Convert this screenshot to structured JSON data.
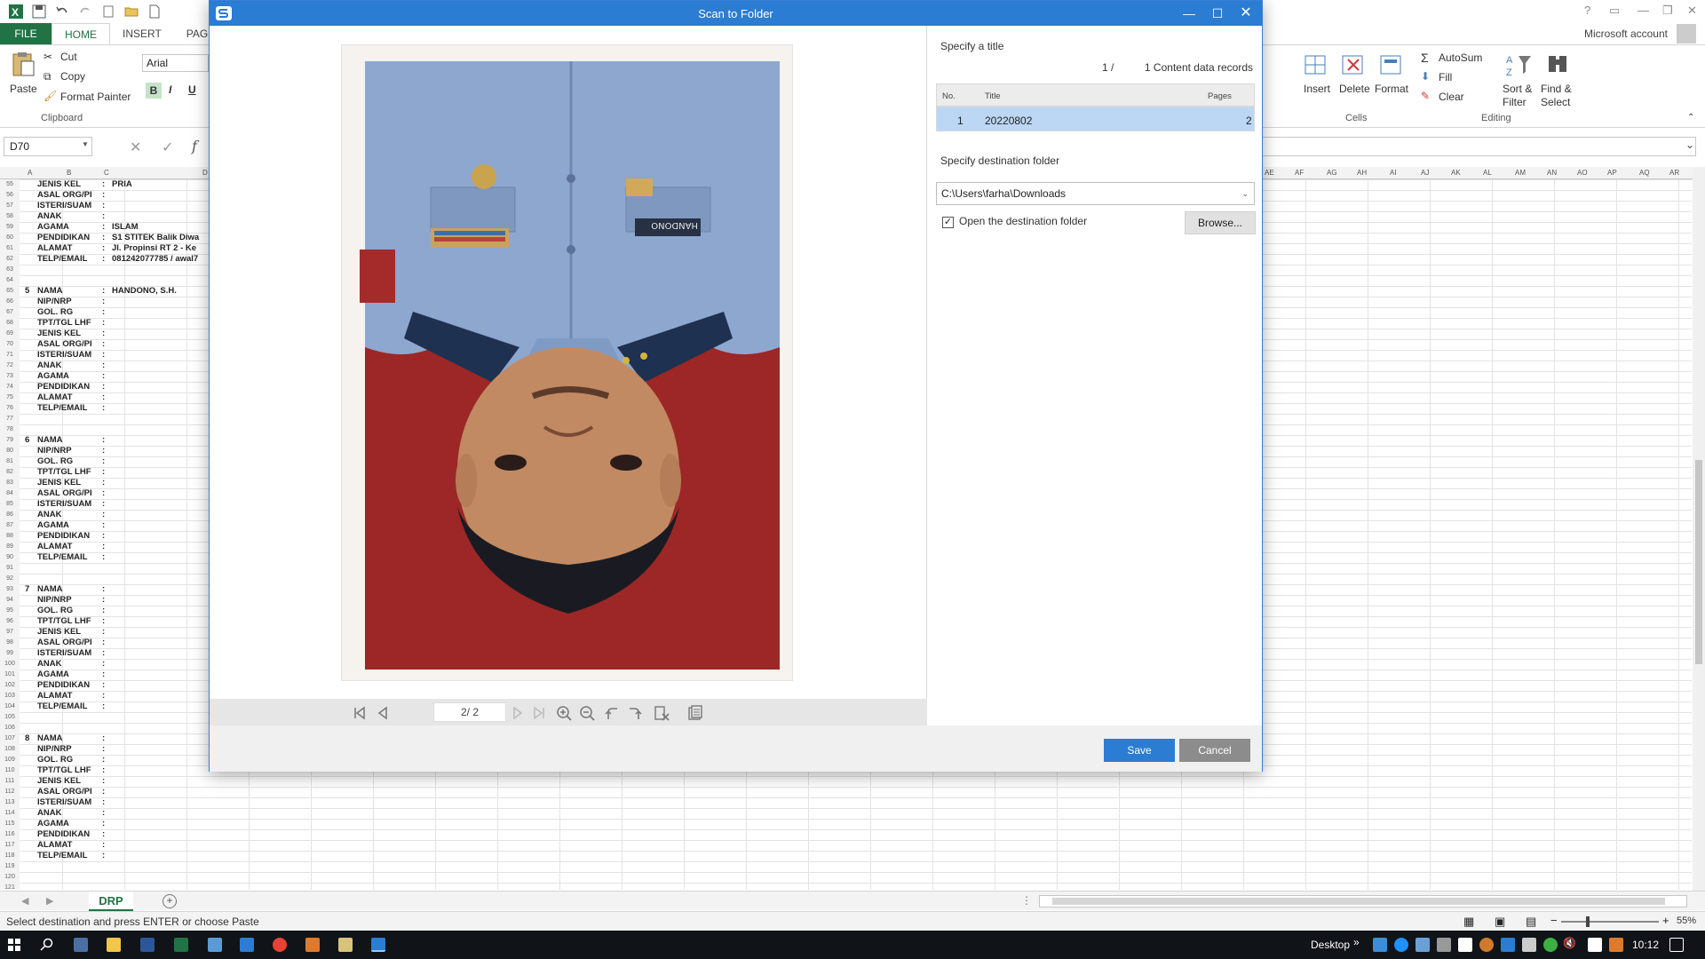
{
  "excel": {
    "tabs": [
      "FILE",
      "HOME",
      "INSERT",
      "PAGE"
    ],
    "account": "Microsoft account",
    "clipboard": {
      "paste": "Paste",
      "cut": "Cut",
      "copy": "Copy",
      "format_painter": "Format Painter",
      "group_label": "Clipboard"
    },
    "font_name": "Arial",
    "font_buttons": [
      "B",
      "I",
      "U"
    ],
    "cells_group": {
      "insert": "Insert",
      "delete": "Delete",
      "format": "Format",
      "label": "Cells"
    },
    "editing_group": {
      "autosum": "AutoSum",
      "fill": "Fill",
      "clear": "Clear",
      "sort_filter_1": "Sort &",
      "sort_filter_2": "Filter",
      "find_select_1": "Find &",
      "find_select_2": "Select",
      "label": "Editing"
    },
    "name_box": "D70",
    "col_headers": [
      "A",
      "B",
      "C",
      "D",
      "AE",
      "AF",
      "AG",
      "AH",
      "AI",
      "AJ",
      "AK",
      "AL",
      "AM",
      "AN",
      "AO",
      "AP",
      "AQ",
      "AR"
    ],
    "rows": [
      {
        "n": "55",
        "a": "",
        "b": "JENIS KEL",
        "c": ":",
        "d": "PRIA"
      },
      {
        "n": "56",
        "a": "",
        "b": "ASAL ORG/PI",
        "c": ":",
        "d": ""
      },
      {
        "n": "57",
        "a": "",
        "b": "ISTERI/SUAM",
        "c": ":",
        "d": ""
      },
      {
        "n": "58",
        "a": "",
        "b": "ANAK",
        "c": ":",
        "d": ""
      },
      {
        "n": "59",
        "a": "",
        "b": "AGAMA",
        "c": ":",
        "d": "ISLAM"
      },
      {
        "n": "60",
        "a": "",
        "b": "PENDIDIKAN",
        "c": ":",
        "d": "S1 STITEK Balik Diwa"
      },
      {
        "n": "61",
        "a": "",
        "b": "ALAMAT",
        "c": ":",
        "d": "Jl. Propinsi RT 2 - Ke"
      },
      {
        "n": "62",
        "a": "",
        "b": "TELP/EMAIL",
        "c": ":",
        "d": "081242077785 / awal7"
      },
      {
        "n": "63",
        "a": "",
        "b": "",
        "c": "",
        "d": ""
      },
      {
        "n": "64",
        "a": "",
        "b": "",
        "c": "",
        "d": ""
      },
      {
        "n": "65",
        "a": "5",
        "b": "NAMA",
        "c": ":",
        "d": "HANDONO, S.H."
      },
      {
        "n": "66",
        "a": "",
        "b": "NIP/NRP",
        "c": ":",
        "d": ""
      },
      {
        "n": "67",
        "a": "",
        "b": "GOL. RG",
        "c": ":",
        "d": ""
      },
      {
        "n": "68",
        "a": "",
        "b": "TPT/TGL LHF",
        "c": ":",
        "d": ""
      },
      {
        "n": "69",
        "a": "",
        "b": "JENIS KEL",
        "c": ":",
        "d": ""
      },
      {
        "n": "70",
        "a": "",
        "b": "ASAL ORG/PI",
        "c": ":",
        "d": ""
      },
      {
        "n": "71",
        "a": "",
        "b": "ISTERI/SUAM",
        "c": ":",
        "d": ""
      },
      {
        "n": "72",
        "a": "",
        "b": "ANAK",
        "c": ":",
        "d": ""
      },
      {
        "n": "73",
        "a": "",
        "b": "AGAMA",
        "c": ":",
        "d": ""
      },
      {
        "n": "74",
        "a": "",
        "b": "PENDIDIKAN",
        "c": ":",
        "d": ""
      },
      {
        "n": "75",
        "a": "",
        "b": "ALAMAT",
        "c": ":",
        "d": ""
      },
      {
        "n": "76",
        "a": "",
        "b": "TELP/EMAIL",
        "c": ":",
        "d": ""
      },
      {
        "n": "77",
        "a": "",
        "b": "",
        "c": "",
        "d": ""
      },
      {
        "n": "78",
        "a": "",
        "b": "",
        "c": "",
        "d": ""
      },
      {
        "n": "79",
        "a": "6",
        "b": "NAMA",
        "c": ":",
        "d": ""
      },
      {
        "n": "80",
        "a": "",
        "b": "NIP/NRP",
        "c": ":",
        "d": ""
      },
      {
        "n": "81",
        "a": "",
        "b": "GOL. RG",
        "c": ":",
        "d": ""
      },
      {
        "n": "82",
        "a": "",
        "b": "TPT/TGL LHF",
        "c": ":",
        "d": ""
      },
      {
        "n": "83",
        "a": "",
        "b": "JENIS KEL",
        "c": ":",
        "d": ""
      },
      {
        "n": "84",
        "a": "",
        "b": "ASAL ORG/PI",
        "c": ":",
        "d": ""
      },
      {
        "n": "85",
        "a": "",
        "b": "ISTERI/SUAM",
        "c": ":",
        "d": ""
      },
      {
        "n": "86",
        "a": "",
        "b": "ANAK",
        "c": ":",
        "d": ""
      },
      {
        "n": "87",
        "a": "",
        "b": "AGAMA",
        "c": ":",
        "d": ""
      },
      {
        "n": "88",
        "a": "",
        "b": "PENDIDIKAN",
        "c": ":",
        "d": ""
      },
      {
        "n": "89",
        "a": "",
        "b": "ALAMAT",
        "c": ":",
        "d": ""
      },
      {
        "n": "90",
        "a": "",
        "b": "TELP/EMAIL",
        "c": ":",
        "d": ""
      },
      {
        "n": "91",
        "a": "",
        "b": "",
        "c": "",
        "d": ""
      },
      {
        "n": "92",
        "a": "",
        "b": "",
        "c": "",
        "d": ""
      },
      {
        "n": "93",
        "a": "7",
        "b": "NAMA",
        "c": ":",
        "d": ""
      },
      {
        "n": "94",
        "a": "",
        "b": "NIP/NRP",
        "c": ":",
        "d": ""
      },
      {
        "n": "95",
        "a": "",
        "b": "GOL. RG",
        "c": ":",
        "d": ""
      },
      {
        "n": "96",
        "a": "",
        "b": "TPT/TGL LHF",
        "c": ":",
        "d": ""
      },
      {
        "n": "97",
        "a": "",
        "b": "JENIS KEL",
        "c": ":",
        "d": ""
      },
      {
        "n": "98",
        "a": "",
        "b": "ASAL ORG/PI",
        "c": ":",
        "d": ""
      },
      {
        "n": "99",
        "a": "",
        "b": "ISTERI/SUAM",
        "c": ":",
        "d": ""
      },
      {
        "n": "100",
        "a": "",
        "b": "ANAK",
        "c": ":",
        "d": ""
      },
      {
        "n": "101",
        "a": "",
        "b": "AGAMA",
        "c": ":",
        "d": ""
      },
      {
        "n": "102",
        "a": "",
        "b": "PENDIDIKAN",
        "c": ":",
        "d": ""
      },
      {
        "n": "103",
        "a": "",
        "b": "ALAMAT",
        "c": ":",
        "d": ""
      },
      {
        "n": "104",
        "a": "",
        "b": "TELP/EMAIL",
        "c": ":",
        "d": ""
      },
      {
        "n": "105",
        "a": "",
        "b": "",
        "c": "",
        "d": ""
      },
      {
        "n": "106",
        "a": "",
        "b": "",
        "c": "",
        "d": ""
      },
      {
        "n": "107",
        "a": "8",
        "b": "NAMA",
        "c": ":",
        "d": ""
      },
      {
        "n": "108",
        "a": "",
        "b": "NIP/NRP",
        "c": ":",
        "d": ""
      },
      {
        "n": "109",
        "a": "",
        "b": "GOL. RG",
        "c": ":",
        "d": ""
      },
      {
        "n": "110",
        "a": "",
        "b": "TPT/TGL LHF",
        "c": ":",
        "d": ""
      },
      {
        "n": "111",
        "a": "",
        "b": "JENIS KEL",
        "c": ":",
        "d": ""
      },
      {
        "n": "112",
        "a": "",
        "b": "ASAL ORG/PI",
        "c": ":",
        "d": ""
      },
      {
        "n": "113",
        "a": "",
        "b": "ISTERI/SUAM",
        "c": ":",
        "d": ""
      },
      {
        "n": "114",
        "a": "",
        "b": "ANAK",
        "c": ":",
        "d": ""
      },
      {
        "n": "115",
        "a": "",
        "b": "AGAMA",
        "c": ":",
        "d": ""
      },
      {
        "n": "116",
        "a": "",
        "b": "PENDIDIKAN",
        "c": ":",
        "d": ""
      },
      {
        "n": "117",
        "a": "",
        "b": "ALAMAT",
        "c": ":",
        "d": ""
      },
      {
        "n": "118",
        "a": "",
        "b": "TELP/EMAIL",
        "c": ":",
        "d": ""
      },
      {
        "n": "119",
        "a": "",
        "b": "",
        "c": "",
        "d": ""
      },
      {
        "n": "120",
        "a": "",
        "b": "",
        "c": "",
        "d": ""
      },
      {
        "n": "121",
        "a": "",
        "b": "",
        "c": "",
        "d": ""
      }
    ],
    "sheet_tab": "DRP",
    "status_message": "Select destination and press ENTER or choose Paste",
    "zoom": "55%",
    "accent_color": "#217346"
  },
  "dialog": {
    "title": "Scan to Folder",
    "specify_title_label": "Specify a title",
    "records_index": "1 /",
    "records_label": "1 Content data records",
    "table_headers": {
      "no": "No.",
      "title": "Title",
      "pages": "Pages"
    },
    "record": {
      "no": "1",
      "title": "20220802",
      "pages": "2"
    },
    "dest_label": "Specify destination folder",
    "dest_path": "C:\\Users\\farha\\Downloads",
    "open_folder_label": "Open the destination folder",
    "open_folder_checked": true,
    "browse_label": "Browse...",
    "page_indicator": "2/  2",
    "save_label": "Save",
    "cancel_label": "Cancel",
    "preview": {
      "name_tag": "HANDONO"
    },
    "accent_color": "#2b7cd3"
  },
  "taskbar": {
    "desktop_label": "Desktop",
    "time": "10:12"
  }
}
